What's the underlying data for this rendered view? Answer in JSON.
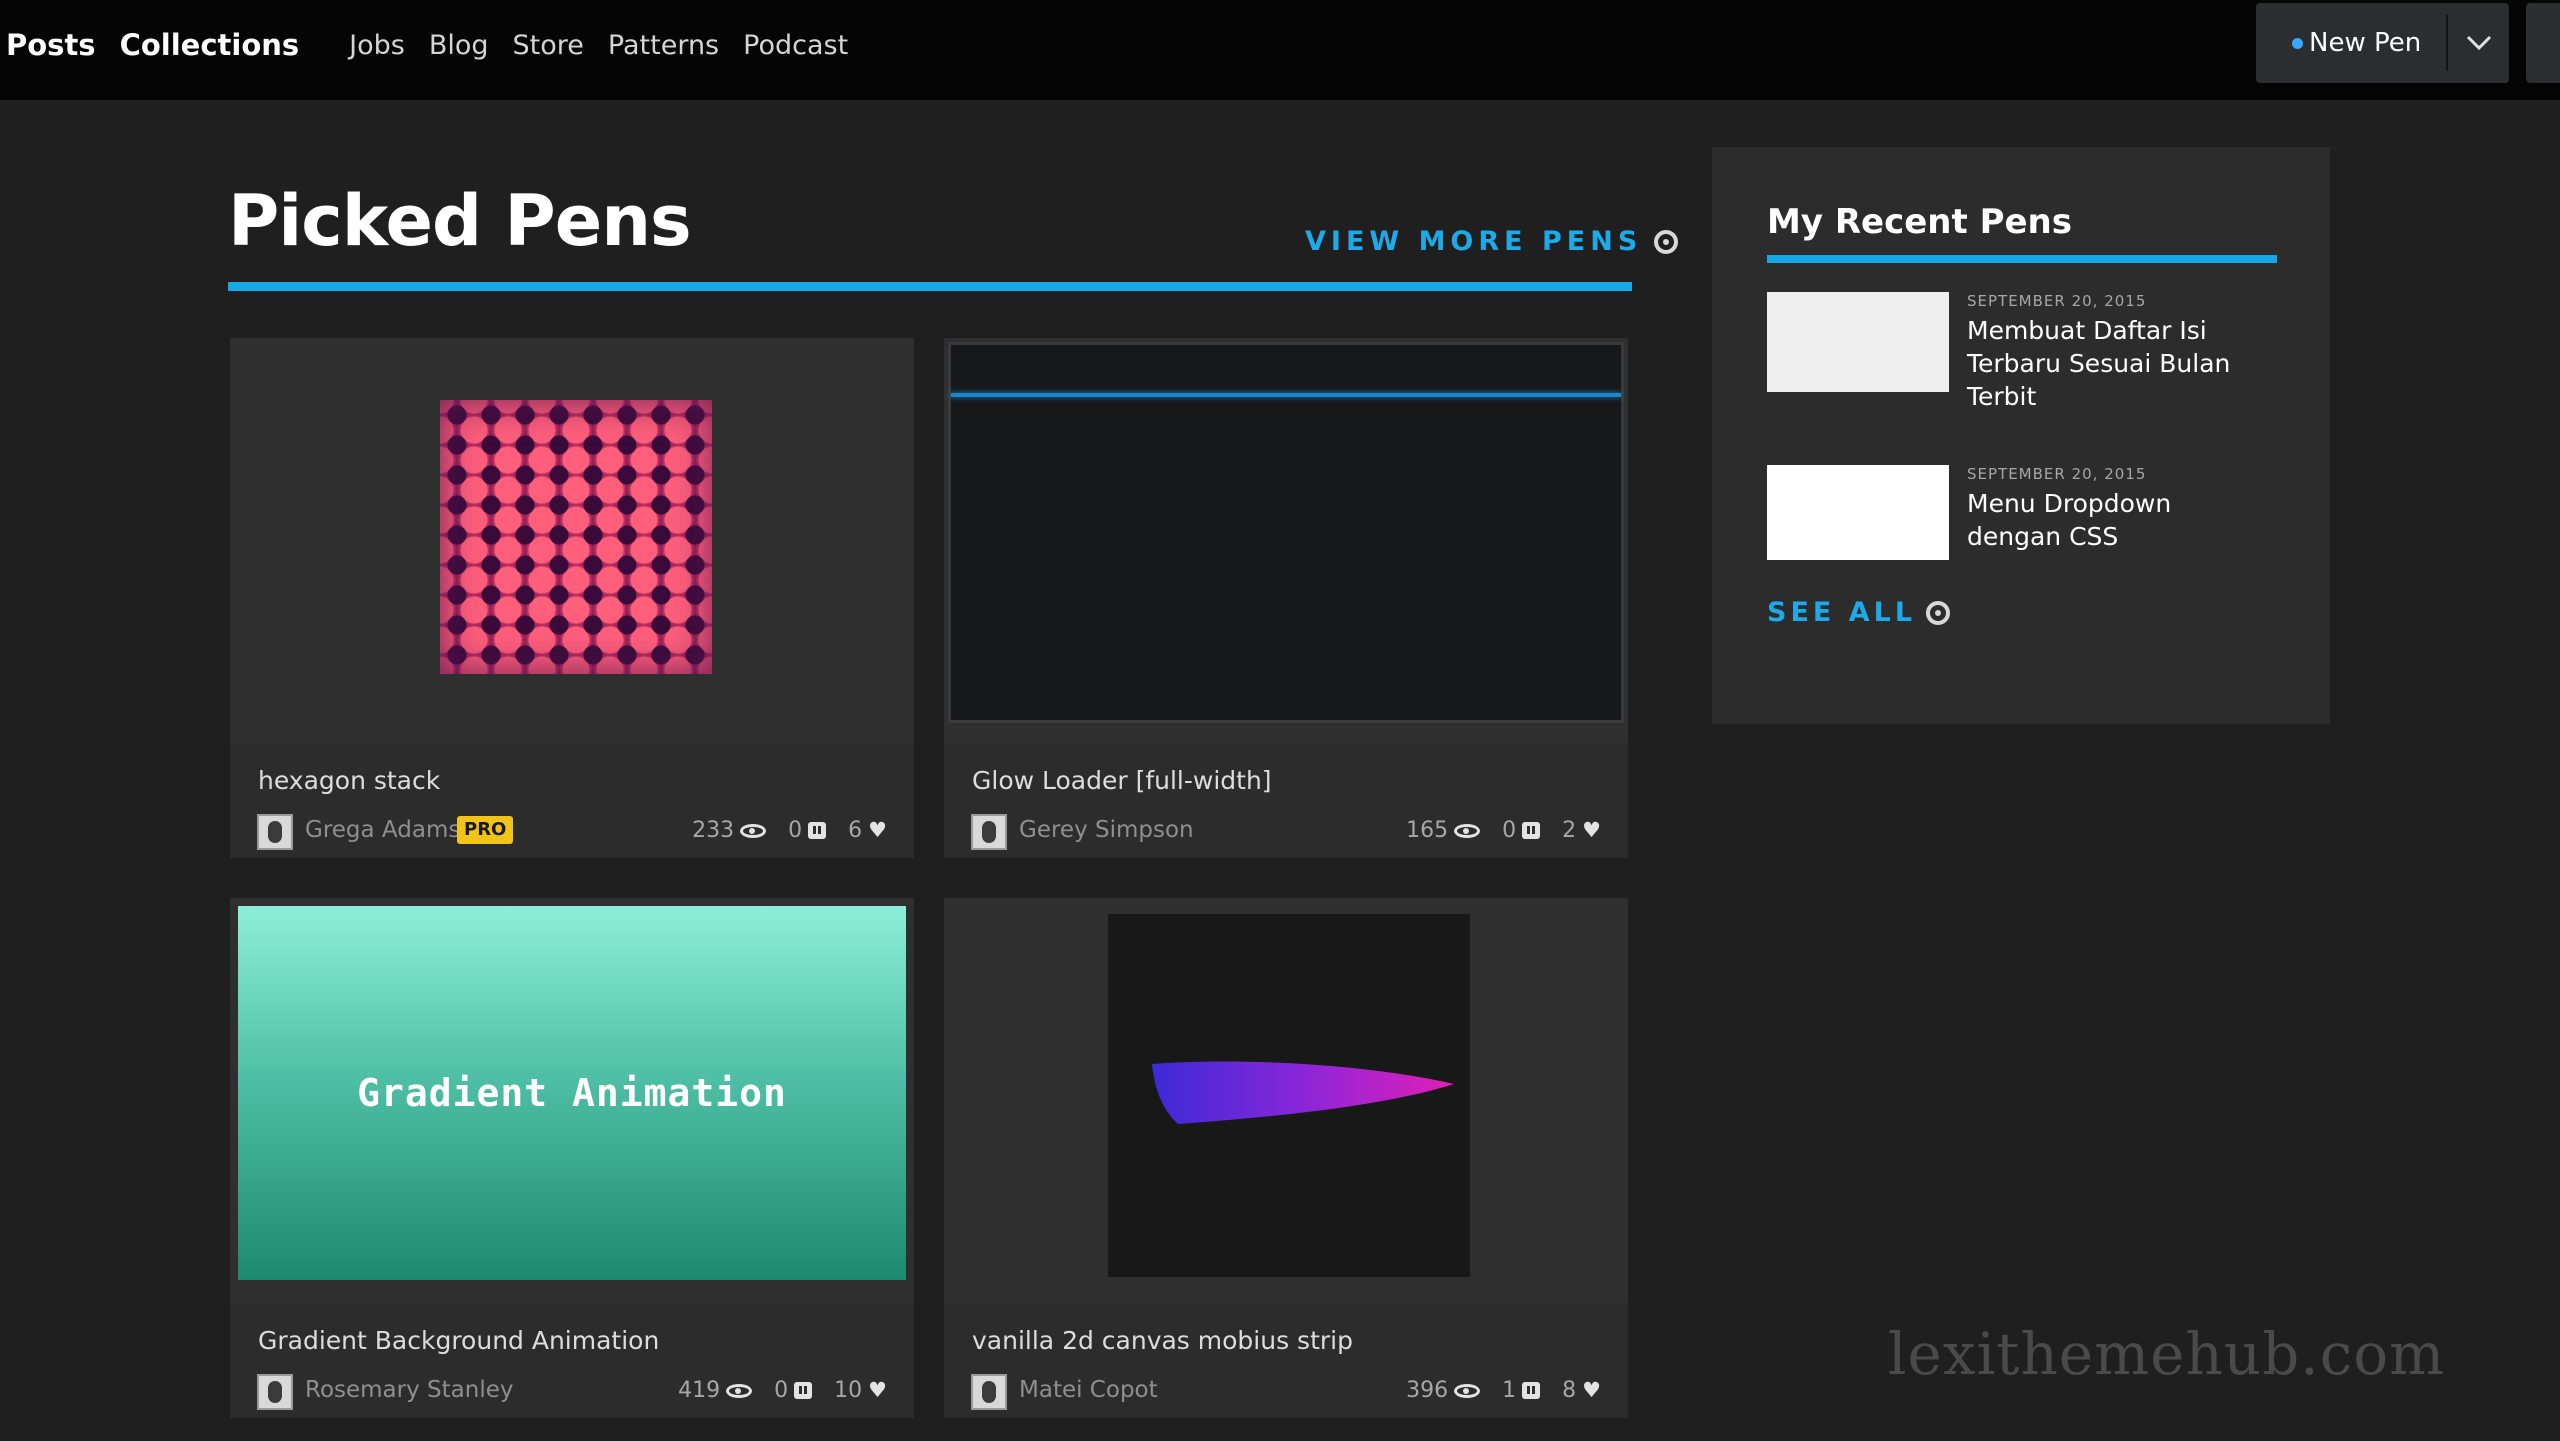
{
  "nav": {
    "posts": "Posts",
    "collections": "Collections",
    "links": [
      "Jobs",
      "Blog",
      "Store",
      "Patterns",
      "Podcast"
    ],
    "new_pen": "New Pen"
  },
  "picked": {
    "title": "Picked Pens",
    "view_more": "VIEW MORE PENS"
  },
  "cards": [
    {
      "title": "hexagon stack",
      "author": "Grega Adams",
      "badge": "PRO",
      "views": "233",
      "comments": "0",
      "hearts": "6"
    },
    {
      "title": "Glow Loader [full-width]",
      "author": "Gerey Simpson",
      "views": "165",
      "comments": "0",
      "hearts": "2"
    },
    {
      "title": "Gradient Background Animation",
      "author": "Rosemary Stanley",
      "thumb_text": "Gradient Animation",
      "views": "419",
      "comments": "0",
      "hearts": "10"
    },
    {
      "title": "vanilla 2d canvas mobius strip",
      "author": "Matei Copot",
      "views": "396",
      "comments": "1",
      "hearts": "8"
    }
  ],
  "sidebar": {
    "title": "My Recent Pens",
    "items": [
      {
        "date": "SEPTEMBER 20, 2015",
        "title": "Membuat Daftar Isi Terbaru Sesuai Bulan Terbit"
      },
      {
        "date": "SEPTEMBER 20, 2015",
        "title": "Menu Dropdown dengan CSS"
      }
    ],
    "see_all": "SEE ALL"
  },
  "watermark": "lexithemehub.com",
  "colors": {
    "accent": "#15a7e6",
    "pro_badge": "#f2c418",
    "background": "#1f1f20",
    "card": "#2c2c2d"
  }
}
